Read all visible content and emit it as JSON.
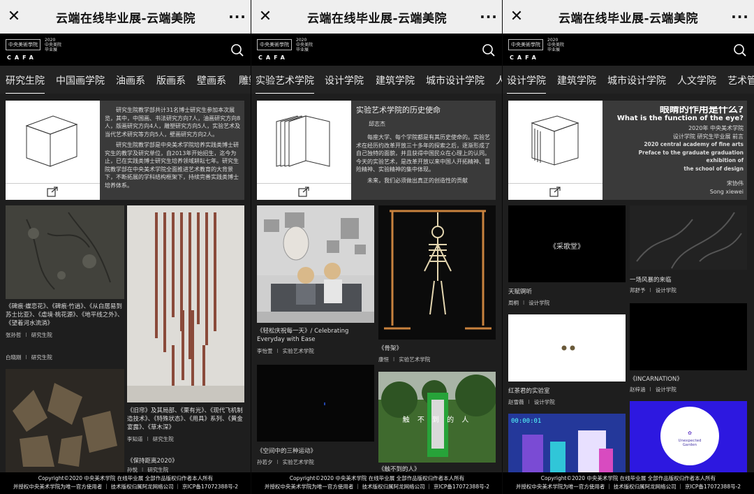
{
  "titlebar": {
    "title": "云端在线毕业展-云端美院"
  },
  "header": {
    "logo_text": "中央美術學院",
    "logo_letters": "CAFA",
    "year": "2020",
    "year_sub": "中央美院毕业展"
  },
  "panels": [
    {
      "tabs": [
        "研究生院",
        "中国画学院",
        "油画系",
        "版画系",
        "壁画系",
        "雕塑系"
      ],
      "card": {
        "paragraphs": [
          "研究生院教学部共计31名博士研究生参加本次展览，其中，中国画、书法研究方向7人，油画研究方向8人，版画研究方向4人，雕塑研究方向5人，实验艺术及当代艺术研究等方向5人，壁画研究方向2人。",
          "研究生院教学部是中央美术学院培养实践类博士研究生的教学及研究单位，自2013年开始招生，迄今为止，已在实践类博士研究生培养领域耕耘七年。研究生院教学部在中央美术学院全面推进艺术教育的大背景下，不断拓展的学科结构框架下，持续完善实践类博士培养体系。"
        ]
      },
      "items": [
        {
          "caption": "《碑痕·蝶恋花》、《碑痕·竹逍》、《从白居易到苏士比亚》、《虐境·桃花源》、《地平线之外》、《望着河水流淌》",
          "author": "张孙哲",
          "dept": "研究生院"
        },
        {
          "caption": "",
          "author": "白晓刚",
          "dept": "研究生院"
        },
        {
          "caption": "《旧帘》及其局部、《栗有光》、《现代飞机制造技术》、《特殊状态》、《用具》系列、《黄金宴露》、《草木深》",
          "author": "李知道",
          "dept": "研究生院"
        },
        {
          "caption": "《保持距离2020》",
          "author": "孙悦",
          "dept": "研究生院"
        }
      ]
    },
    {
      "tabs": [
        "实验艺术学院",
        "设计学院",
        "建筑学院",
        "城市设计学院",
        "人文学院"
      ],
      "card": {
        "heading": "实验艺术学院的历史使命",
        "author": "邱志杰",
        "paragraphs": [
          "每座大学、每个学院都是有其历史使命的。实验艺术在经历约改革开放三十多年的探索之后，逐渐形成了自己独特的面貌，并且获得中国民众在心理上的认同。今天的实验艺术，是改革开放以来中国人开拓精神、冒险精神、实验精神的集中体现。",
          "未来，我们必须做出真正的创造性的贡献"
        ]
      },
      "items": [
        {
          "caption": "《轻松庆祝每一天》/ Celebrating Everyday with Ease",
          "author": "李怡萱",
          "dept": "实验艺术学院"
        },
        {
          "caption": "《骨架》",
          "author": "康恒",
          "dept": "实验艺术学院"
        },
        {
          "caption": "《空间中的三种运动》",
          "author": "孙若夕",
          "dept": "实验艺术学院"
        },
        {
          "caption": "《触不到的人》",
          "author": "",
          "dept": ""
        },
        {
          "caption": "触 不 到 的 人",
          "author": "",
          "dept": ""
        }
      ]
    },
    {
      "tabs": [
        "设计学院",
        "建筑学院",
        "城市设计学院",
        "人文学院",
        "艺术管理"
      ],
      "card": {
        "heading_cn": "眼睛的作用是什么?",
        "heading_en": "What is the function of the eye?",
        "lines": [
          "2020年 中央美术学院",
          "设计学院 研究生毕业展 前言",
          "2020 central academy of fine arts",
          "Preface to the graduate graduation exhibition of",
          "the school of design"
        ],
        "sign_cn": "宋协伟",
        "sign_en": "Song xiewei"
      },
      "items": [
        {
          "caption": "天赋锕听",
          "author": "周桐",
          "dept": "设计学院",
          "overlay": "《采歌堂》"
        },
        {
          "caption": "一场风暴的来临",
          "author": "邦舒予",
          "dept": "设计学院"
        },
        {
          "caption": "红茶君的实验室",
          "author": "赵雪薇",
          "dept": "设计学院"
        },
        {
          "caption": "《INCARNATION》",
          "author": "赵梓涵",
          "dept": "设计学院"
        },
        {
          "caption": "00:00:01",
          "author": "",
          "dept": ""
        },
        {
          "caption": "Unexpected Garden",
          "author": "",
          "dept": ""
        }
      ]
    }
  ],
  "footer": {
    "line1": "Copyright©2020 中央美术学院 在线毕业展 全部作品版权归作者本人所有",
    "line2": "并授权中央美术学院为唯一官方使用者 ｜ 技术版权归属阿龙网络公司 ｜ 京ICP备17072388号-2"
  },
  "colors": {
    "titlebar_bg": "#efefef",
    "page_bg": "#1e1e1e",
    "header_bg": "#000000",
    "card_bg": "#3a3a3a"
  }
}
